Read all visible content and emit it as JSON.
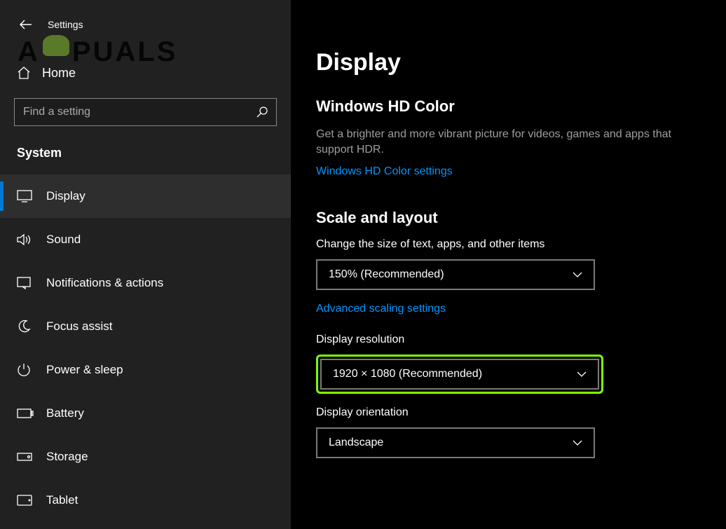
{
  "title": "Settings",
  "home_label": "Home",
  "search_placeholder": "Find a setting",
  "section": "System",
  "watermark": "A   PUALS",
  "nav": {
    "items": [
      {
        "key": "display",
        "label": "Display",
        "icon": "monitor-icon",
        "active": true
      },
      {
        "key": "sound",
        "label": "Sound",
        "icon": "sound-icon",
        "active": false
      },
      {
        "key": "notifications",
        "label": "Notifications & actions",
        "icon": "notifications-icon",
        "active": false
      },
      {
        "key": "focus",
        "label": "Focus assist",
        "icon": "moon-icon",
        "active": false
      },
      {
        "key": "power",
        "label": "Power & sleep",
        "icon": "power-icon",
        "active": false
      },
      {
        "key": "battery",
        "label": "Battery",
        "icon": "battery-icon",
        "active": false
      },
      {
        "key": "storage",
        "label": "Storage",
        "icon": "storage-icon",
        "active": false
      },
      {
        "key": "tablet",
        "label": "Tablet",
        "icon": "tablet-icon",
        "active": false
      }
    ]
  },
  "main": {
    "page_title": "Display",
    "hd_color": {
      "title": "Windows HD Color",
      "body": "Get a brighter and more vibrant picture for videos, games and apps that support HDR.",
      "link": "Windows HD Color settings"
    },
    "scale": {
      "title": "Scale and layout",
      "text_size_label": "Change the size of text, apps, and other items",
      "text_size_value": "150% (Recommended)",
      "advanced_link": "Advanced scaling settings",
      "resolution_label": "Display resolution",
      "resolution_value": "1920 × 1080 (Recommended)",
      "orientation_label": "Display orientation",
      "orientation_value": "Landscape"
    }
  }
}
